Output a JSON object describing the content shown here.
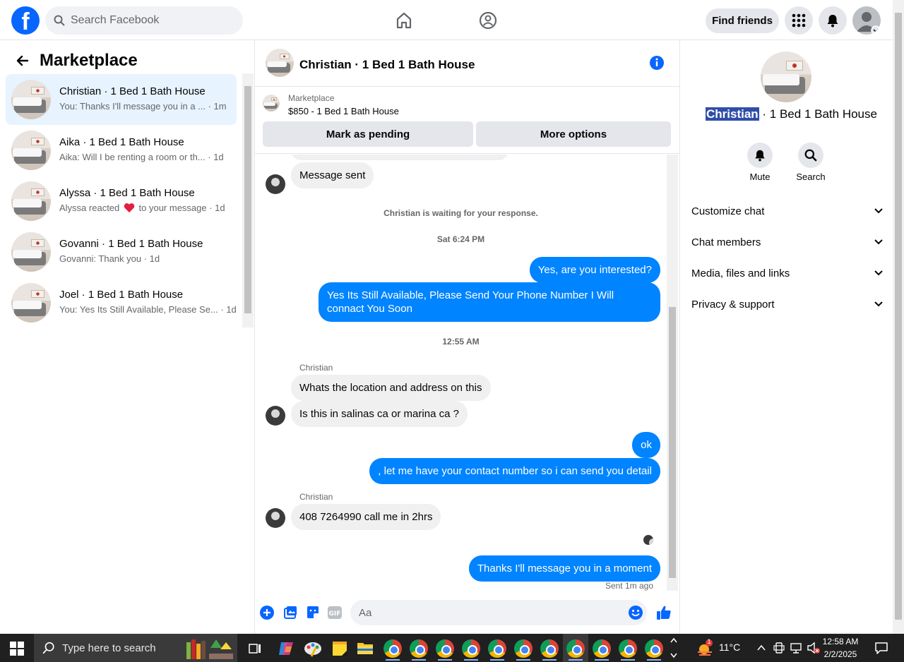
{
  "topbar": {
    "search_placeholder": "Search Facebook",
    "find_friends_label": "Find friends",
    "brand_color": "#0866ff"
  },
  "left": {
    "title": "Marketplace",
    "conversations": [
      {
        "name": "Christian · 1 Bed 1 Bath House",
        "message": "You: Thanks I'll message you in a ... · 1m",
        "active": true
      },
      {
        "name": "Aika · 1 Bed 1 Bath House",
        "message": "Aika: Will I be renting a room or th... · 1d",
        "active": false
      },
      {
        "name": "Alyssa · 1 Bed 1 Bath House",
        "message_before": "Alyssa reacted",
        "message_after": "to your message · 1d",
        "reaction_icon": "heart-icon",
        "active": false
      },
      {
        "name": "Govanni · 1 Bed 1 Bath House",
        "message": "Govanni: Thank you · 1d",
        "active": false
      },
      {
        "name": "Joel · 1 Bed 1 Bath House",
        "message": "You: Yes Its Still Available, Please Se... · 1d",
        "active": false
      }
    ]
  },
  "chat": {
    "title": "Christian · 1 Bed 1 Bath House",
    "marketplace_label": "Marketplace",
    "listing": "$850 - 1 Bed 1 Bath House",
    "mark_pending": "Mark as pending",
    "more_options": "More options",
    "messages": {
      "m1": "Message sent",
      "note_waiting": "Christian is waiting for your response.",
      "time1": "Sat 6:24 PM",
      "out1": "Yes, are you interested?",
      "out2": "Yes Its Still Available, Please Send Your Phone Number I Will connact You Soon",
      "time2": "12:55 AM",
      "sender1": "Christian",
      "in1": "Whats the location and address on this",
      "in2": "Is this in salinas ca or marina ca ?",
      "out3": "ok",
      "out4": ", let me have your contact number so i can send you detail",
      "sender2": "Christian",
      "in3": "408 7264990 call me in 2hrs",
      "out5": "Thanks I'll message you in a moment",
      "status": "Sent 1m ago"
    },
    "composer_placeholder": "Aa",
    "accent_color": "#0084ff"
  },
  "right": {
    "title_name": "Christian",
    "title_rest": " · 1 Bed 1 Bath House",
    "mute_label": "Mute",
    "search_label": "Search",
    "sections": [
      "Customize chat",
      "Chat members",
      "Media, files and links",
      "Privacy & support"
    ]
  },
  "taskbar": {
    "search_placeholder": "Type here to search",
    "temperature": "11°C",
    "time": "12:58 AM",
    "date": "2/2/2025",
    "weather_badge": "1"
  }
}
